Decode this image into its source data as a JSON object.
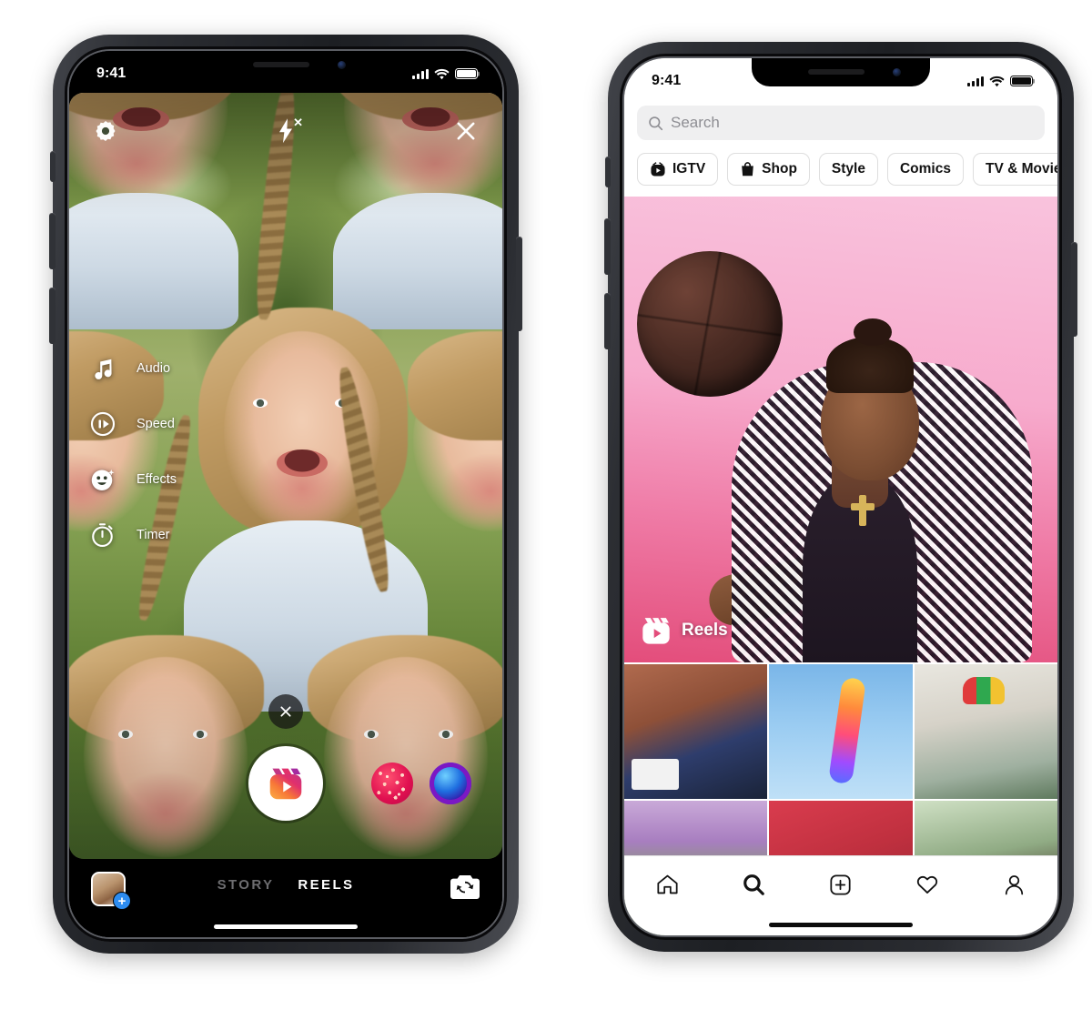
{
  "meta": {
    "scene_title": "Instagram Reels — camera capture and Explore tab on two iPhones"
  },
  "phone_left": {
    "status_bar": {
      "time": "9:41",
      "cellular": "signal-bars-icon",
      "wifi": "wifi-icon",
      "battery": "battery-full-icon"
    },
    "camera_top": {
      "settings_label": "Settings",
      "settings_icon": "gear-icon",
      "flash_label": "Flash off",
      "flash_icon": "flash-off-icon",
      "close_label": "Close",
      "close_icon": "close-x-icon"
    },
    "tools": [
      {
        "label": "Audio",
        "icon": "music-note-icon"
      },
      {
        "label": "Speed",
        "icon": "speed-icon"
      },
      {
        "label": "Effects",
        "icon": "effects-smiley-icon"
      },
      {
        "label": "Timer",
        "icon": "timer-icon"
      }
    ],
    "effect_close": {
      "label": "Remove effect",
      "icon": "close-x-icon"
    },
    "shutter": {
      "label": "Record",
      "icon": "reels-clapperboard-icon"
    },
    "effect_carousel": [
      {
        "name": "hearts-effect"
      },
      {
        "name": "blue-orb-effect"
      }
    ],
    "footer": {
      "gallery_label": "Gallery",
      "gallery_add_badge": "+",
      "modes": [
        {
          "label": "STORY",
          "active": false
        },
        {
          "label": "REELS",
          "active": true
        }
      ],
      "flip_camera_label": "Flip camera",
      "flip_camera_icon": "camera-flip-icon"
    }
  },
  "phone_right": {
    "status_bar": {
      "time": "9:41",
      "cellular": "signal-bars-icon",
      "wifi": "wifi-icon",
      "battery": "battery-full-icon"
    },
    "search": {
      "placeholder": "Search",
      "value": "",
      "icon": "search-icon"
    },
    "chips": [
      {
        "label": "IGTV",
        "icon": "igtv-icon"
      },
      {
        "label": "Shop",
        "icon": "shopping-bag-icon"
      },
      {
        "label": "Style",
        "icon": ""
      },
      {
        "label": "Comics",
        "icon": ""
      },
      {
        "label": "TV & Movies",
        "icon": ""
      }
    ],
    "hero": {
      "badge_label": "Reels",
      "badge_icon": "reels-clapperboard-icon"
    },
    "grid_items": [
      {
        "name": "thumb-two-people-drawing"
      },
      {
        "name": "thumb-rainbow-nails-hand"
      },
      {
        "name": "thumb-person-sunglasses-beanie"
      },
      {
        "name": "thumb-flowers"
      },
      {
        "name": "thumb-red-fabric"
      },
      {
        "name": "thumb-portrait-greenery"
      }
    ],
    "nav": [
      {
        "label": "Home",
        "icon": "home-icon",
        "active": false
      },
      {
        "label": "Search",
        "icon": "search-icon",
        "active": true
      },
      {
        "label": "Create",
        "icon": "plus-box-icon",
        "active": false
      },
      {
        "label": "Activity",
        "icon": "heart-icon",
        "active": false
      },
      {
        "label": "Profile",
        "icon": "person-icon",
        "active": false
      }
    ]
  },
  "colors": {
    "instagram_pink": "#e1306c",
    "instagram_orange": "#f77737",
    "instagram_yellow": "#fcaf45",
    "instagram_purple": "#833ab4",
    "accent_blue": "#2d8cf0",
    "hero_pink_light": "#f9c3dd",
    "hero_pink_deep": "#e34d7b",
    "chip_border": "#dedede",
    "search_bg": "#efeff0",
    "placeholder": "#8e8e93"
  }
}
